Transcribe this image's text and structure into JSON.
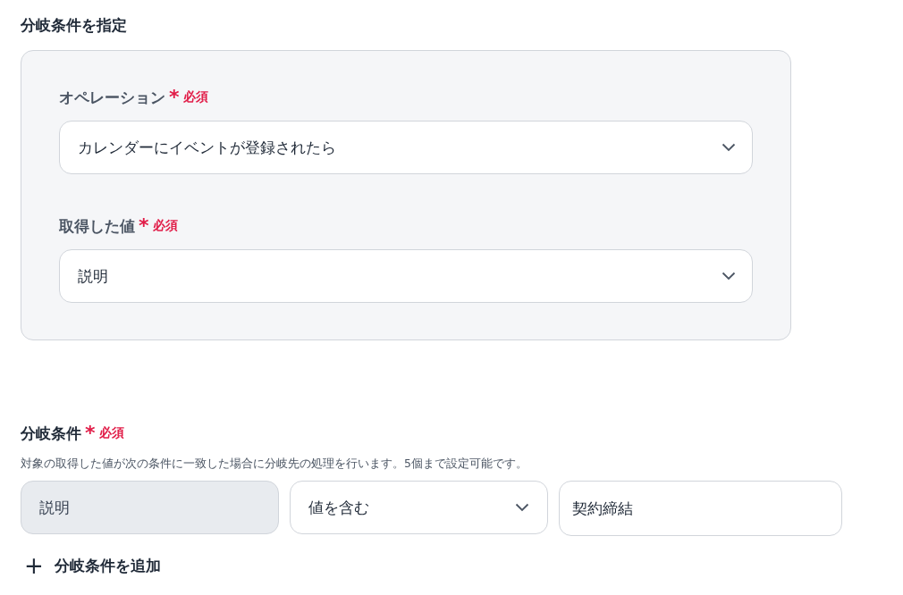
{
  "section_title": "分岐条件を指定",
  "panel": {
    "fields": [
      {
        "label": "オペレーション",
        "required_mark": "*",
        "required_text": "必須",
        "value": "カレンダーにイベントが登録されたら"
      },
      {
        "label": "取得した値",
        "required_mark": "*",
        "required_text": "必須",
        "value": "説明"
      }
    ]
  },
  "conditions": {
    "label": "分岐条件",
    "required_mark": "*",
    "required_text": "必須",
    "description": "対象の取得した値が次の条件に一致した場合に分岐先の処理を行います。5個まで設定可能です。",
    "row": [
      {
        "kind": "readonly",
        "value": "説明"
      },
      {
        "kind": "select",
        "value": "値を含む"
      },
      {
        "kind": "text",
        "value": "契約締結"
      }
    ],
    "add_icon": "+",
    "add_label": "分岐条件を追加"
  }
}
